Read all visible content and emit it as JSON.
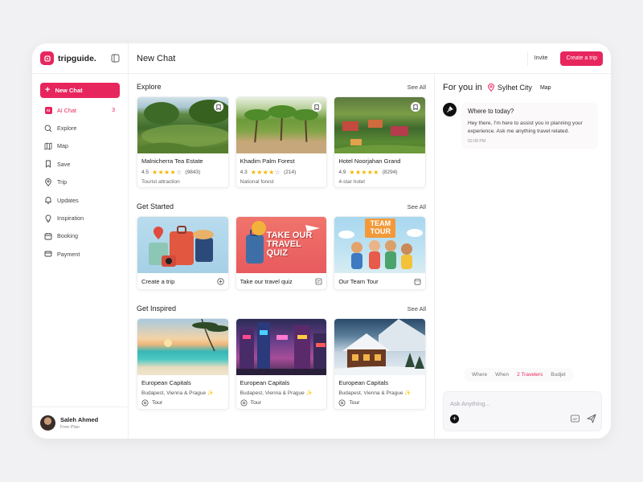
{
  "brand": {
    "name": "tripguide."
  },
  "sidebar": {
    "new_chat": "New Chat",
    "items": [
      {
        "label": "AI Chat",
        "icon": "ai-icon",
        "count": "3",
        "active": true
      },
      {
        "label": "Explore",
        "icon": "search-icon"
      },
      {
        "label": "Map",
        "icon": "map-icon"
      },
      {
        "label": "Save",
        "icon": "bookmark-icon"
      },
      {
        "label": "Trip",
        "icon": "pin-icon"
      },
      {
        "label": "Updates",
        "icon": "bell-icon"
      },
      {
        "label": "Inspiration",
        "icon": "lightbulb-icon"
      },
      {
        "label": "Booking",
        "icon": "calendar-icon"
      },
      {
        "label": "Payment",
        "icon": "card-icon"
      }
    ],
    "user": {
      "name": "Saleh Ahmed",
      "plan": "Free Plan"
    }
  },
  "header": {
    "title": "New Chat",
    "invite": "Invite",
    "create_trip": "Create a trip"
  },
  "explore": {
    "title": "Explore",
    "see_all": "See All",
    "cards": [
      {
        "title": "Malnicherra Tea Estate",
        "rating": "4.5",
        "stars": 4.5,
        "reviews": "(9843)",
        "type": "Tourist attraction"
      },
      {
        "title": "Khadim Palm Forest",
        "rating": "4.3",
        "stars": 4.5,
        "reviews": "(214)",
        "type": "National forest"
      },
      {
        "title": "Hotel Noorjahan Grand",
        "rating": "4.9",
        "stars": 5,
        "reviews": "(8294)",
        "type": "4-star hotel"
      }
    ]
  },
  "get_started": {
    "title": "Get Started",
    "see_all": "See All",
    "cards": [
      {
        "label": "Create a trip",
        "icon": "plus-circle-icon"
      },
      {
        "label": "Take our travel quiz",
        "icon": "quiz-icon",
        "art_text": "TAKE OUR TRAVEL QUIZ"
      },
      {
        "label": "Our Team Tour",
        "icon": "calendar-icon",
        "art_text": "TEAM TOUR"
      }
    ]
  },
  "get_inspired": {
    "title": "Get Inspired",
    "see_all": "See All",
    "cards": [
      {
        "title": "European Capitals",
        "sub": "Budapest, Vienna & Prague ✨",
        "tag": "Tour"
      },
      {
        "title": "European Capitals",
        "sub": "Budapest, Vienna & Prague ✨",
        "tag": "Tour"
      },
      {
        "title": "European Capitals",
        "sub": "Budapest, Vienna & Prague ✨",
        "tag": "Tour"
      }
    ]
  },
  "panel": {
    "title": "For you in",
    "city": "Sylhet City",
    "map": "Map",
    "message": {
      "title": "Where to today?",
      "text": "Hey there, I'm here to assist you in planning your experience. Ask me anything travel related.",
      "time": "02:08 PM"
    },
    "chips": [
      "Where",
      "When",
      "2 Travelers",
      "Budjet"
    ],
    "composer_placeholder": "Ask Anything..."
  },
  "colors": {
    "accent": "#e8265e"
  }
}
